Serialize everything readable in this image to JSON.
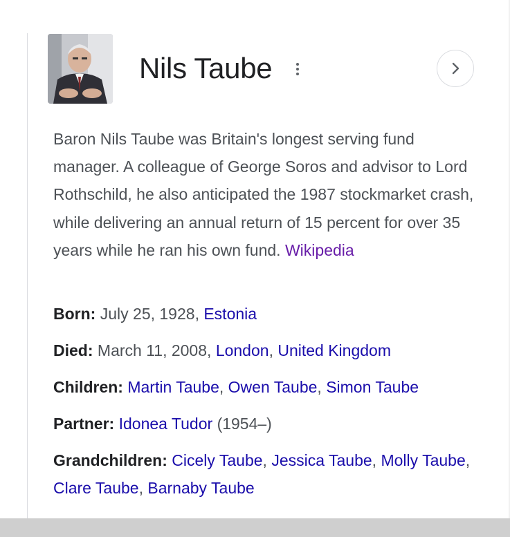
{
  "header": {
    "title": "Nils Taube",
    "more_icon": "more-vert-icon",
    "next_icon": "chevron-right-icon"
  },
  "description": {
    "text": "Baron Nils Taube was Britain's longest serving fund manager. A colleague of George Soros and advisor to Lord Rothschild, he also anticipated the 1987 stockmarket crash, while delivering an annual return of 15 percent for over 35 years while he ran his own fund.",
    "source_label": "Wikipedia"
  },
  "facts": {
    "born": {
      "label": "Born",
      "colon": ":",
      "date": "July 25, 1928",
      "sep1": ", ",
      "place": "Estonia"
    },
    "died": {
      "label": "Died",
      "colon": ":",
      "date": "March 11, 2008",
      "sep1": ", ",
      "place1": "London",
      "sep2": ", ",
      "place2": "United Kingdom"
    },
    "children": {
      "label": "Children",
      "colon": ":",
      "names": [
        "Martin Taube",
        "Owen Taube",
        "Simon Taube"
      ],
      "sep": ", "
    },
    "partner": {
      "label": "Partner",
      "colon": ":",
      "name": "Idonea Tudor",
      "years": "(1954–)"
    },
    "grandchildren": {
      "label": "Grandchildren",
      "colon": ":",
      "names": [
        "Cicely Taube",
        "Jessica Taube",
        "Molly Taube",
        "Clare Taube",
        "Barnaby Taube"
      ],
      "sep": ", "
    }
  },
  "colors": {
    "link": "#1a0dab",
    "visited_link": "#681da8",
    "text": "#4d5156",
    "label": "#202124"
  }
}
